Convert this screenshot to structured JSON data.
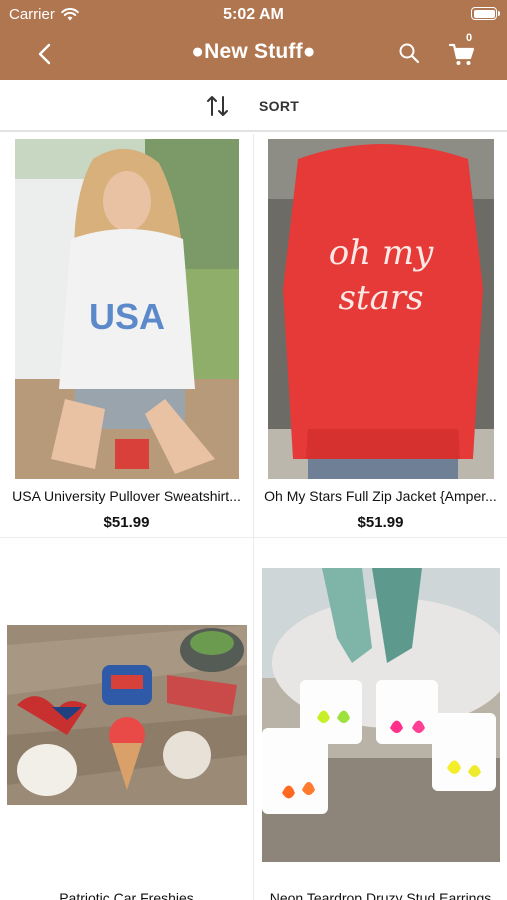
{
  "status_bar": {
    "carrier": "Carrier",
    "time": "5:02 AM"
  },
  "nav": {
    "title": "●New Stuff●",
    "cart_count": "0",
    "icons": [
      "chevron-left-icon",
      "search-icon",
      "cart-icon"
    ]
  },
  "sort": {
    "label": "SORT",
    "icon": "sort-arrows-icon"
  },
  "products": [
    {
      "name": "USA University Pullover Sweatshirt...",
      "price": "$51.99"
    },
    {
      "name": "Oh My Stars Full Zip Jacket {Amper...",
      "price": "$51.99"
    },
    {
      "name": "Patriotic Car Freshies",
      "price": ""
    },
    {
      "name": "Neon Teardrop Druzy Stud Earrings",
      "price": ""
    }
  ],
  "colors": {
    "header": "#b07650",
    "text": "#111111",
    "divider": "#ececec"
  }
}
